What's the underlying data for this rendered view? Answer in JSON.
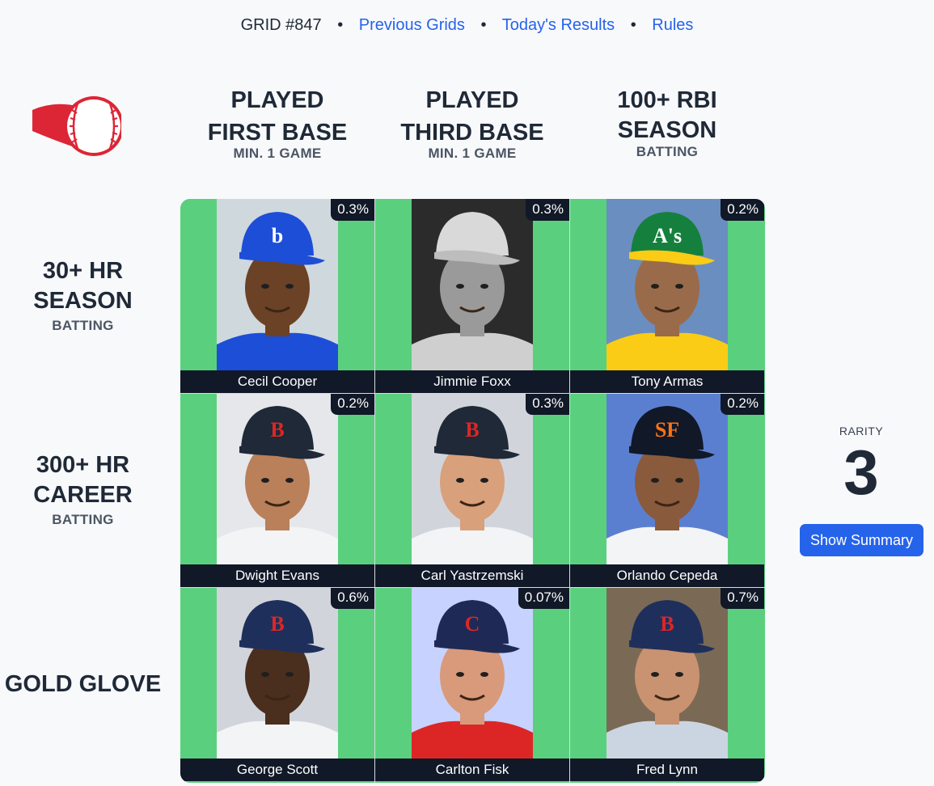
{
  "nav": {
    "grid_label": "GRID #847",
    "previous": "Previous Grids",
    "results": "Today's Results",
    "rules": "Rules"
  },
  "columns": [
    {
      "title1": "PLAYED",
      "title2": "FIRST BASE",
      "sub": "MIN. 1 GAME"
    },
    {
      "title1": "PLAYED",
      "title2": "THIRD BASE",
      "sub": "MIN. 1 GAME"
    },
    {
      "title1": "100+ RBI",
      "title2": "SEASON",
      "sub": "BATTING"
    }
  ],
  "rows": [
    {
      "title1": "30+ HR",
      "title2": "SEASON",
      "sub": "BATTING"
    },
    {
      "title1": "300+ HR",
      "title2": "CAREER",
      "sub": "BATTING"
    },
    {
      "title1": "GOLD GLOVE",
      "title2": "",
      "sub": ""
    }
  ],
  "cells": [
    [
      {
        "name": "Cecil Cooper",
        "pct": "0.3%",
        "cap_letter": "b",
        "cap_color": "#1d4ed8",
        "skin": "#6b4226",
        "bg": "#cfd8dc",
        "jersey": "#1d4ed8",
        "bw": false
      },
      {
        "name": "Jimmie Foxx",
        "pct": "0.3%",
        "cap_letter": "",
        "cap_color": "#d9d9d9",
        "skin": "#9a9a9a",
        "bg": "#2b2b2b",
        "jersey": "#cfcfcf",
        "bw": true
      },
      {
        "name": "Tony Armas",
        "pct": "0.2%",
        "cap_letter": "A's",
        "cap_color": "#15803d",
        "skin": "#9a6b4a",
        "bg": "#6a8ec0",
        "jersey": "#facc15",
        "bw": false
      }
    ],
    [
      {
        "name": "Dwight Evans",
        "pct": "0.2%",
        "cap_letter": "B",
        "cap_color": "#1f2937",
        "skin": "#b9805a",
        "bg": "#e5e7eb",
        "jersey": "#f3f4f6",
        "bw": false
      },
      {
        "name": "Carl Yastrzemski",
        "pct": "0.3%",
        "cap_letter": "B",
        "cap_color": "#1f2937",
        "skin": "#d9a07c",
        "bg": "#d1d5db",
        "jersey": "#f3f4f6",
        "bw": false
      },
      {
        "name": "Orlando Cepeda",
        "pct": "0.2%",
        "cap_letter": "SF",
        "cap_color": "#111827",
        "skin": "#8a5a3c",
        "bg": "#5b7fd0",
        "jersey": "#f3f4f6",
        "bw": false
      }
    ],
    [
      {
        "name": "George Scott",
        "pct": "0.6%",
        "cap_letter": "B",
        "cap_color": "#1f2f5c",
        "skin": "#4a2e1e",
        "bg": "#d1d5db",
        "jersey": "#f3f4f6",
        "bw": false
      },
      {
        "name": "Carlton Fisk",
        "pct": "0.07%",
        "cap_letter": "C",
        "cap_color": "#1e2a55",
        "skin": "#d89a7a",
        "bg": "#c7d2fe",
        "jersey": "#dc2626",
        "bw": false
      },
      {
        "name": "Fred Lynn",
        "pct": "0.7%",
        "cap_letter": "B",
        "cap_color": "#1f2f5c",
        "skin": "#c99270",
        "bg": "#7a6a55",
        "jersey": "#cbd5e1",
        "bw": false
      }
    ]
  ],
  "rarity": {
    "label": "RARITY",
    "value": "3"
  },
  "summary_button": "Show Summary",
  "colors": {
    "cell_correct": "#5ad07f",
    "accent": "#2563eb",
    "dark": "#111827"
  }
}
